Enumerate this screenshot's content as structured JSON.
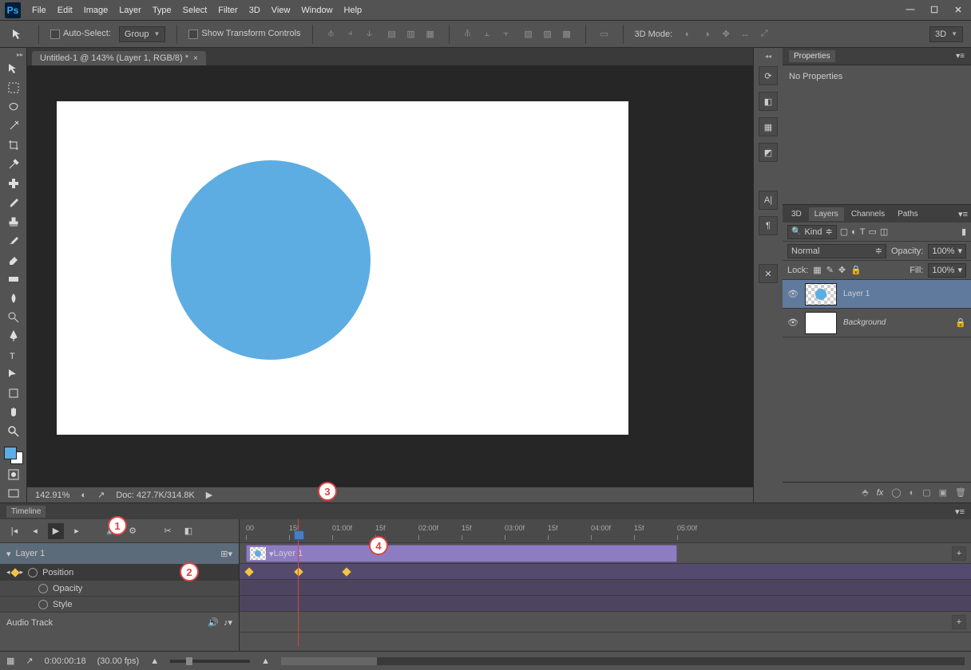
{
  "menubar": [
    "File",
    "Edit",
    "Image",
    "Layer",
    "Type",
    "Select",
    "Filter",
    "3D",
    "View",
    "Window",
    "Help"
  ],
  "optionsbar": {
    "auto_select": "Auto-Select:",
    "group": "Group",
    "show_transform": "Show Transform Controls",
    "mode_3d": "3D Mode:",
    "dropdown_3d": "3D"
  },
  "doc_tab": {
    "title": "Untitled-1 @ 143% (Layer 1, RGB/8) *"
  },
  "status": {
    "zoom": "142.91%",
    "doc_size": "Doc: 427.7K/314.8K"
  },
  "properties": {
    "title": "Properties",
    "empty": "No Properties"
  },
  "layers_panel": {
    "tabs": [
      "3D",
      "Layers",
      "Channels",
      "Paths"
    ],
    "kind": "Kind",
    "mode": "Normal",
    "opacity_label": "Opacity:",
    "opacity": "100%",
    "lock_label": "Lock:",
    "fill_label": "Fill:",
    "fill": "100%",
    "layers": [
      {
        "name": "Layer 1",
        "selected": true,
        "checker": true,
        "locked": false
      },
      {
        "name": "Background",
        "selected": false,
        "checker": false,
        "locked": true
      }
    ]
  },
  "timeline": {
    "title": "Timeline",
    "layer_label": "Layer 1",
    "props": [
      "Position",
      "Opacity",
      "Style"
    ],
    "audio": "Audio Track",
    "clip_label": "Layer 1",
    "ticks": [
      "00",
      "15f",
      "01:00f",
      "15f",
      "02:00f",
      "15f",
      "03:00f",
      "15f",
      "04:00f",
      "15f",
      "05:00f"
    ],
    "timecode": "0:00:00:18",
    "fps": "(30.00 fps)"
  },
  "callouts": [
    "1",
    "2",
    "3",
    "4"
  ]
}
